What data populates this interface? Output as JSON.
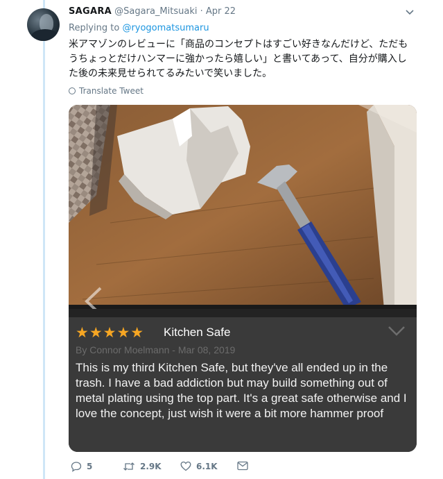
{
  "tweet": {
    "author_name": "SAGARA",
    "author_handle": "@Sagara_Mitsuaki",
    "separator": "·",
    "date": "Apr 22",
    "replying_label": "Replying to",
    "replying_handle": "@ryogomatsumaru",
    "text": "米アマゾンのレビューに「商品のコンセプトはすごい好きなんだけど、ただもうちょっとだけハンマーに強かったら嬉しい」と書いてあって、自分が購入した後の未来見せられてるみたいで笑いました。",
    "translate_label": "Translate Tweet"
  },
  "review": {
    "stars": "★★★★★",
    "title": "Kitchen Safe",
    "byline": "By Connor Moelmann - Mar 08, 2019",
    "body": "This is my third Kitchen Safe, but they've all ended up in the trash. I have a bad addiction but may build something out of metal plating using the top part. It's a great safe otherwise and I love the concept, just wish it were a bit more hammer proof"
  },
  "actions": {
    "replies": "5",
    "retweets": "2.9K",
    "likes": "6.1K"
  },
  "icons": {
    "caret": "chevron-down-icon",
    "reply": "reply-icon",
    "retweet": "retweet-icon",
    "like": "heart-icon",
    "dm": "envelope-icon",
    "translate": "globe-icon"
  },
  "colors": {
    "link": "#1b95e0",
    "stars": "#f6a623",
    "thread_line": "#cfe6f7"
  }
}
